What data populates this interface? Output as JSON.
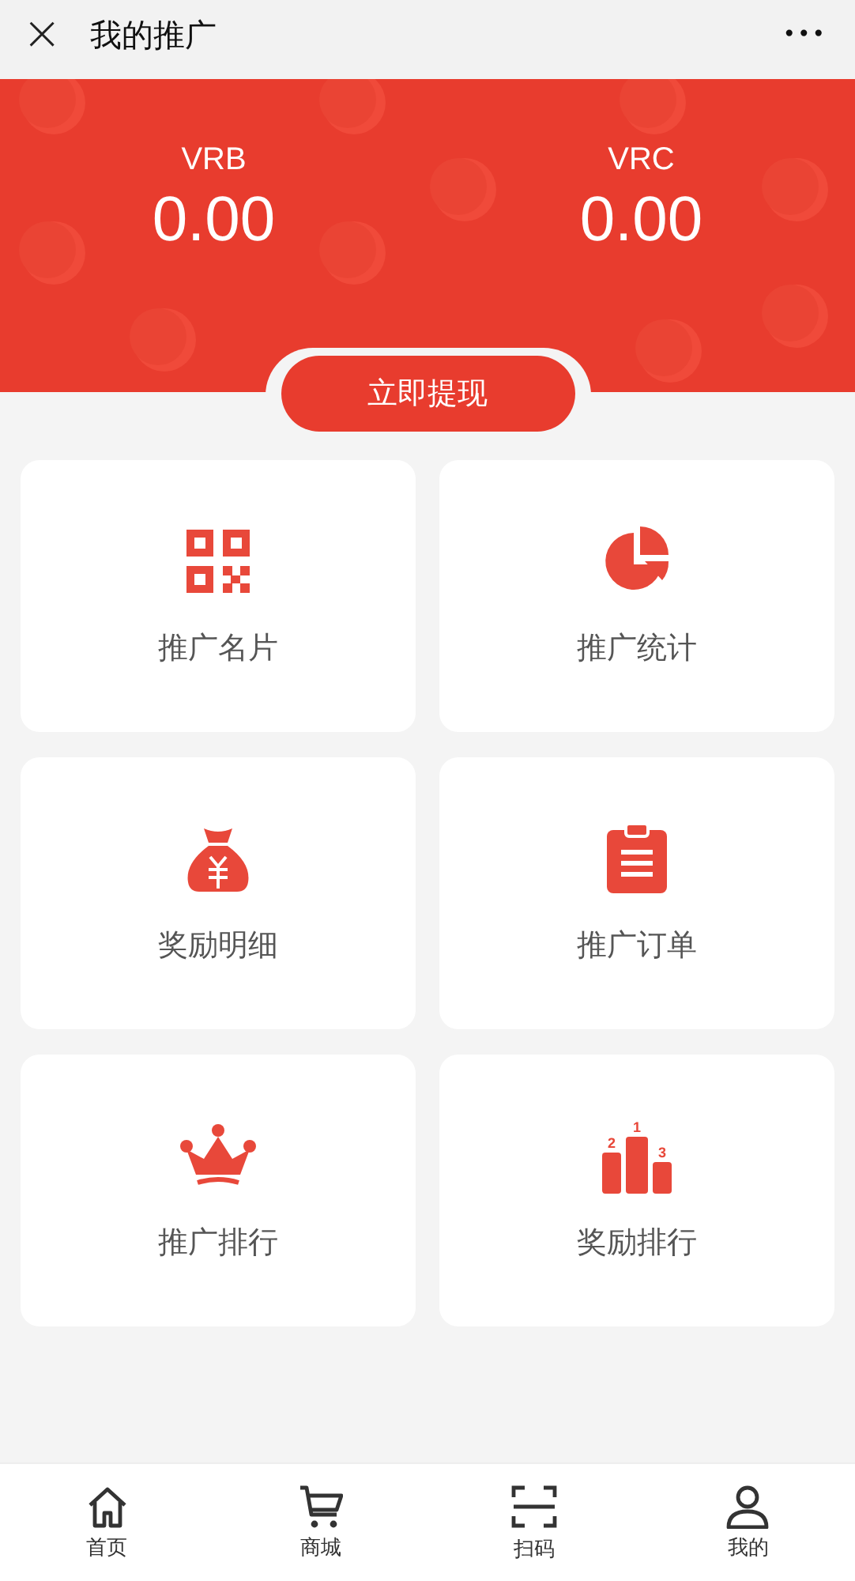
{
  "top_bar": {
    "close": "×",
    "title": "我的推广",
    "more": "•••"
  },
  "balances": [
    {
      "label": "VRB",
      "value": "0.00"
    },
    {
      "label": "VRC",
      "value": "0.00"
    }
  ],
  "withdraw_button": "立即提现",
  "menu": [
    {
      "kind": "qr",
      "label": "推广名片"
    },
    {
      "kind": "pie",
      "label": "推广统计"
    },
    {
      "kind": "bag",
      "label": "奖励明细"
    },
    {
      "kind": "clipboard",
      "label": "推广订单"
    },
    {
      "kind": "crown",
      "label": "推广排行"
    },
    {
      "kind": "podium",
      "label": "奖励排行"
    }
  ],
  "podium_rank_labels": [
    "2",
    "1",
    "3"
  ],
  "bottom_nav": [
    {
      "kind": "home",
      "label": "首页"
    },
    {
      "kind": "cart",
      "label": "商城"
    },
    {
      "kind": "scan",
      "label": "扫码"
    },
    {
      "kind": "user",
      "label": "我的"
    }
  ]
}
